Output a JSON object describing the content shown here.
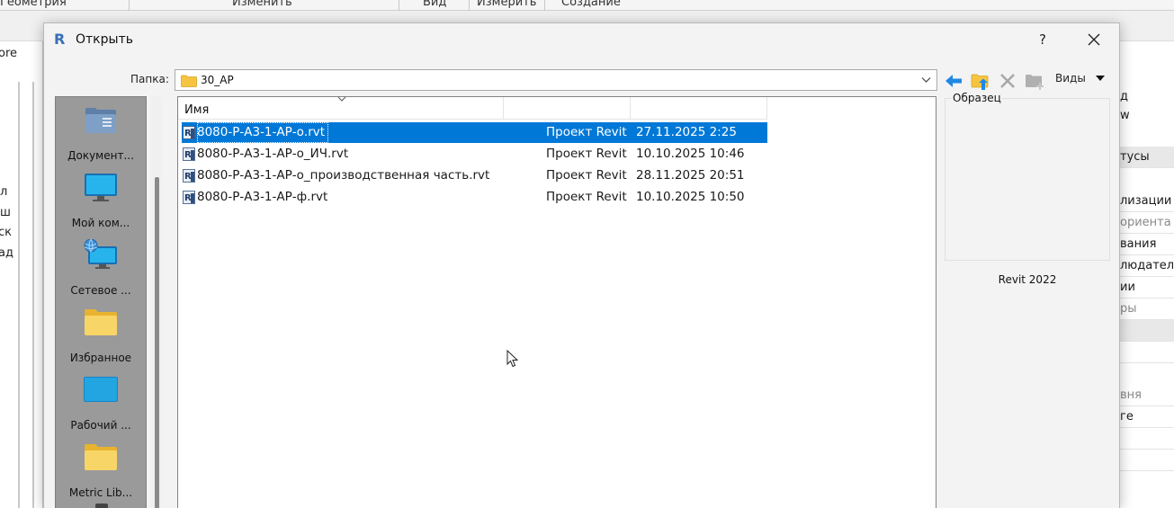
{
  "ribbon": {
    "tabs": [
      "Геометрия",
      "Изменить",
      "Вид",
      "Измерить",
      "Создание"
    ]
  },
  "background_left": {
    "fragments": [
      "ore",
      "л",
      "ш",
      "ск",
      "ад"
    ]
  },
  "background_right": {
    "rows": [
      "д",
      "w",
      "тусы",
      "лизации",
      "ориента",
      "вания",
      "людателя",
      "ии",
      "ры",
      "",
      "",
      "вня",
      "ге",
      "",
      ""
    ]
  },
  "dialog": {
    "title": "Открыть",
    "help_label": "?",
    "folder_label": "Папка:",
    "folder_value": "30_АР",
    "views_label": "Виды",
    "preview_label": "Образец",
    "version_label": "Revit 2022"
  },
  "places": [
    {
      "label": "Документ...",
      "icon": "documents-icon"
    },
    {
      "label": "Мой ком...",
      "icon": "computer-icon"
    },
    {
      "label": "Сетевое ...",
      "icon": "network-icon"
    },
    {
      "label": "Избранное",
      "icon": "folder-icon"
    },
    {
      "label": "Рабочий ...",
      "icon": "desktop-icon"
    },
    {
      "label": "Metric Lib...",
      "icon": "folder-icon"
    }
  ],
  "file_list": {
    "columns": [
      "Имя",
      "",
      ""
    ],
    "rows": [
      {
        "name": "8080-Р-А3-1-АР-о.rvt",
        "type": "Проект Revit",
        "date": "27.11.2025 2:25",
        "selected": true
      },
      {
        "name": "8080-Р-А3-1-АР-о_ИЧ.rvt",
        "type": "Проект Revit",
        "date": "10.10.2025 10:46",
        "selected": false
      },
      {
        "name": "8080-Р-А3-1-АР-о_производственная часть.rvt",
        "type": "Проект Revit",
        "date": "28.11.2025 20:51",
        "selected": false
      },
      {
        "name": "8080-Р-А3-1-АР-ф.rvt",
        "type": "Проект Revit",
        "date": "10.10.2025 10:50",
        "selected": false
      }
    ]
  },
  "colors": {
    "selection": "#0078d7",
    "places_bg": "#9a9a9a",
    "back_arrow": "#1e88e5",
    "folder": "#f5c542"
  }
}
